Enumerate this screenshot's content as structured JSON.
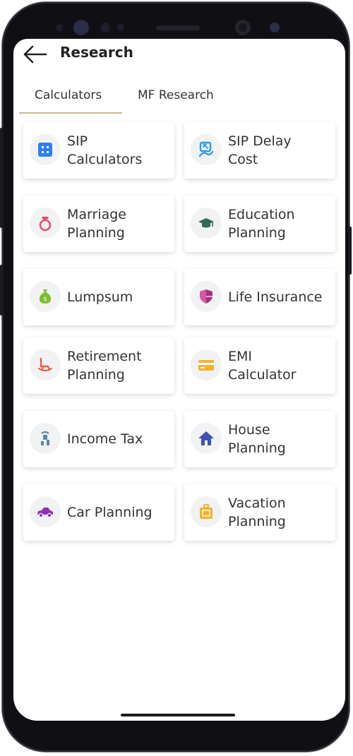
{
  "header": {
    "title": "Research",
    "back_icon": "arrow-left-icon"
  },
  "tabs": [
    {
      "label": "Calculators",
      "active": true
    },
    {
      "label": "MF Research",
      "active": false
    }
  ],
  "accent_color": "#c9b98a",
  "calculators": [
    {
      "label": "SIP\nCalculators",
      "icon": "grid-icon",
      "color": "#2f7ff0"
    },
    {
      "label": "SIP Delay\nCost",
      "icon": "sip-delay-icon",
      "color": "#2f9be8"
    },
    {
      "label": "Marriage\nPlanning",
      "icon": "ring-icon",
      "color": "#ef4d6f"
    },
    {
      "label": "Education\nPlanning",
      "icon": "graduation-cap-icon",
      "color": "#2e6b52"
    },
    {
      "label": "Lumpsum",
      "icon": "money-bag-icon",
      "color": "#7bbf2a"
    },
    {
      "label": "Life Insurance",
      "icon": "shield-icon",
      "color": "#a8317d"
    },
    {
      "label": "Retirement\nPlanning",
      "icon": "rocking-chair-icon",
      "color": "#ef5a4a"
    },
    {
      "label": "EMI\nCalculator",
      "icon": "credit-card-icon",
      "color": "#f4b32b"
    },
    {
      "label": "Income Tax",
      "icon": "income-tax-icon",
      "color": "#5b8aa8"
    },
    {
      "label": "House\nPlanning",
      "icon": "house-icon",
      "color": "#3f51b5"
    },
    {
      "label": "Car Planning",
      "icon": "car-icon",
      "color": "#8e2fb8"
    },
    {
      "label": "Vacation\nPlanning",
      "icon": "suitcase-icon",
      "color": "#f4b32b"
    }
  ]
}
